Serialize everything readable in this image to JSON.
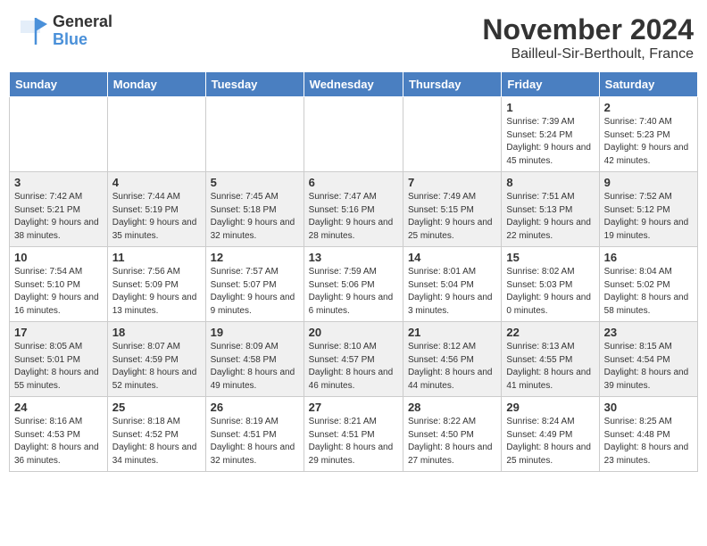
{
  "logo": {
    "general": "General",
    "blue": "Blue"
  },
  "header": {
    "month": "November 2024",
    "location": "Bailleul-Sir-Berthoult, France"
  },
  "weekdays": [
    "Sunday",
    "Monday",
    "Tuesday",
    "Wednesday",
    "Thursday",
    "Friday",
    "Saturday"
  ],
  "weeks": [
    [
      {
        "day": "",
        "info": ""
      },
      {
        "day": "",
        "info": ""
      },
      {
        "day": "",
        "info": ""
      },
      {
        "day": "",
        "info": ""
      },
      {
        "day": "",
        "info": ""
      },
      {
        "day": "1",
        "info": "Sunrise: 7:39 AM\nSunset: 5:24 PM\nDaylight: 9 hours and 45 minutes."
      },
      {
        "day": "2",
        "info": "Sunrise: 7:40 AM\nSunset: 5:23 PM\nDaylight: 9 hours and 42 minutes."
      }
    ],
    [
      {
        "day": "3",
        "info": "Sunrise: 7:42 AM\nSunset: 5:21 PM\nDaylight: 9 hours and 38 minutes."
      },
      {
        "day": "4",
        "info": "Sunrise: 7:44 AM\nSunset: 5:19 PM\nDaylight: 9 hours and 35 minutes."
      },
      {
        "day": "5",
        "info": "Sunrise: 7:45 AM\nSunset: 5:18 PM\nDaylight: 9 hours and 32 minutes."
      },
      {
        "day": "6",
        "info": "Sunrise: 7:47 AM\nSunset: 5:16 PM\nDaylight: 9 hours and 28 minutes."
      },
      {
        "day": "7",
        "info": "Sunrise: 7:49 AM\nSunset: 5:15 PM\nDaylight: 9 hours and 25 minutes."
      },
      {
        "day": "8",
        "info": "Sunrise: 7:51 AM\nSunset: 5:13 PM\nDaylight: 9 hours and 22 minutes."
      },
      {
        "day": "9",
        "info": "Sunrise: 7:52 AM\nSunset: 5:12 PM\nDaylight: 9 hours and 19 minutes."
      }
    ],
    [
      {
        "day": "10",
        "info": "Sunrise: 7:54 AM\nSunset: 5:10 PM\nDaylight: 9 hours and 16 minutes."
      },
      {
        "day": "11",
        "info": "Sunrise: 7:56 AM\nSunset: 5:09 PM\nDaylight: 9 hours and 13 minutes."
      },
      {
        "day": "12",
        "info": "Sunrise: 7:57 AM\nSunset: 5:07 PM\nDaylight: 9 hours and 9 minutes."
      },
      {
        "day": "13",
        "info": "Sunrise: 7:59 AM\nSunset: 5:06 PM\nDaylight: 9 hours and 6 minutes."
      },
      {
        "day": "14",
        "info": "Sunrise: 8:01 AM\nSunset: 5:04 PM\nDaylight: 9 hours and 3 minutes."
      },
      {
        "day": "15",
        "info": "Sunrise: 8:02 AM\nSunset: 5:03 PM\nDaylight: 9 hours and 0 minutes."
      },
      {
        "day": "16",
        "info": "Sunrise: 8:04 AM\nSunset: 5:02 PM\nDaylight: 8 hours and 58 minutes."
      }
    ],
    [
      {
        "day": "17",
        "info": "Sunrise: 8:05 AM\nSunset: 5:01 PM\nDaylight: 8 hours and 55 minutes."
      },
      {
        "day": "18",
        "info": "Sunrise: 8:07 AM\nSunset: 4:59 PM\nDaylight: 8 hours and 52 minutes."
      },
      {
        "day": "19",
        "info": "Sunrise: 8:09 AM\nSunset: 4:58 PM\nDaylight: 8 hours and 49 minutes."
      },
      {
        "day": "20",
        "info": "Sunrise: 8:10 AM\nSunset: 4:57 PM\nDaylight: 8 hours and 46 minutes."
      },
      {
        "day": "21",
        "info": "Sunrise: 8:12 AM\nSunset: 4:56 PM\nDaylight: 8 hours and 44 minutes."
      },
      {
        "day": "22",
        "info": "Sunrise: 8:13 AM\nSunset: 4:55 PM\nDaylight: 8 hours and 41 minutes."
      },
      {
        "day": "23",
        "info": "Sunrise: 8:15 AM\nSunset: 4:54 PM\nDaylight: 8 hours and 39 minutes."
      }
    ],
    [
      {
        "day": "24",
        "info": "Sunrise: 8:16 AM\nSunset: 4:53 PM\nDaylight: 8 hours and 36 minutes."
      },
      {
        "day": "25",
        "info": "Sunrise: 8:18 AM\nSunset: 4:52 PM\nDaylight: 8 hours and 34 minutes."
      },
      {
        "day": "26",
        "info": "Sunrise: 8:19 AM\nSunset: 4:51 PM\nDaylight: 8 hours and 32 minutes."
      },
      {
        "day": "27",
        "info": "Sunrise: 8:21 AM\nSunset: 4:51 PM\nDaylight: 8 hours and 29 minutes."
      },
      {
        "day": "28",
        "info": "Sunrise: 8:22 AM\nSunset: 4:50 PM\nDaylight: 8 hours and 27 minutes."
      },
      {
        "day": "29",
        "info": "Sunrise: 8:24 AM\nSunset: 4:49 PM\nDaylight: 8 hours and 25 minutes."
      },
      {
        "day": "30",
        "info": "Sunrise: 8:25 AM\nSunset: 4:48 PM\nDaylight: 8 hours and 23 minutes."
      }
    ]
  ]
}
